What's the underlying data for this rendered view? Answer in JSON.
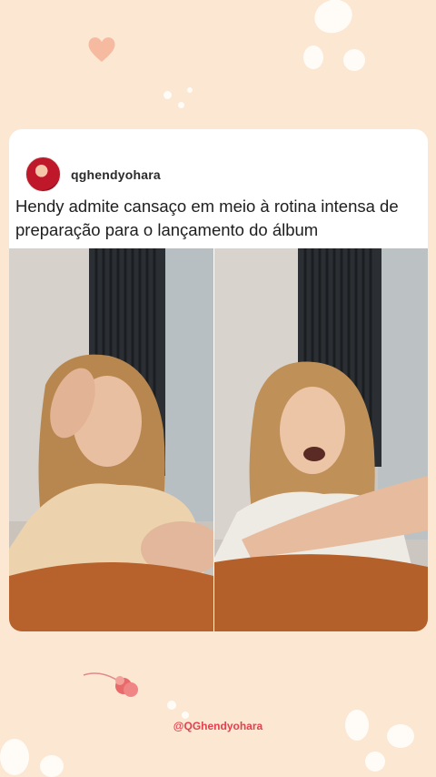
{
  "post": {
    "username": "qghendyohara",
    "caption": "Hendy admite cansaço em meio à rotina intensa de preparação para o lançamento do álbum"
  },
  "footer": {
    "handle": "@QGhendyohara"
  },
  "icons": {
    "heart": "heart-icon",
    "flower": "flower-icon",
    "paw": "paw-print-icon"
  },
  "colors": {
    "background": "#fbe7d2",
    "accent": "#e0424e",
    "card": "#ffffff"
  }
}
